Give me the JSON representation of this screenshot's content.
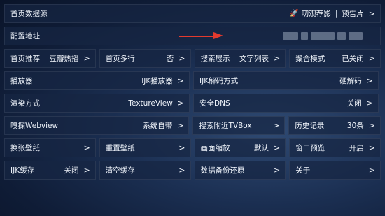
{
  "home_source": {
    "label": "首页数据源",
    "value_a": "叨观荐影",
    "value_b": "预告片",
    "arrow": ">"
  },
  "config_address": {
    "label": "配置地址"
  },
  "rows": [
    [
      {
        "label": "首页推荐",
        "value": "豆瓣热播",
        "arrow": ">"
      },
      {
        "label": "首页多行",
        "value": "否",
        "arrow": ">"
      },
      {
        "label": "搜索展示",
        "value": "文字列表",
        "arrow": ">"
      },
      {
        "label": "聚合模式",
        "value": "已关闭",
        "arrow": ">"
      }
    ],
    [
      {
        "label": "播放器",
        "value": "IJK播放器",
        "arrow": ">"
      },
      {
        "label": "IJK解码方式",
        "value": "硬解码",
        "arrow": ">"
      }
    ],
    [
      {
        "label": "渲染方式",
        "value": "TextureView",
        "arrow": ">"
      },
      {
        "label": "安全DNS",
        "value": "关闭",
        "arrow": ">"
      }
    ],
    [
      {
        "label": "嗅探Webview",
        "value": "系统自带",
        "arrow": ">"
      },
      {
        "label": "搜索附近TVBox",
        "value": "",
        "arrow": ">"
      },
      {
        "label": "历史记录",
        "value": "30条",
        "arrow": ">"
      }
    ],
    [
      {
        "label": "换张壁纸",
        "value": "",
        "arrow": ">"
      },
      {
        "label": "重置壁纸",
        "value": "",
        "arrow": ">"
      },
      {
        "label": "画面缩放",
        "value": "默认",
        "arrow": ">"
      },
      {
        "label": "窗口预览",
        "value": "开启",
        "arrow": ">"
      }
    ],
    [
      {
        "label": "IJK缓存",
        "value": "关闭",
        "arrow": ">"
      },
      {
        "label": "清空缓存",
        "value": "",
        "arrow": ">"
      },
      {
        "label": "数据备份还原",
        "value": "",
        "arrow": ">"
      },
      {
        "label": "关于",
        "value": "",
        "arrow": ">"
      }
    ]
  ],
  "colors": {
    "annotation_arrow": "#e33a2e",
    "cell_bg": "#162642",
    "text": "#eef3fa"
  },
  "icons": {
    "rocket": "rocket-icon"
  }
}
